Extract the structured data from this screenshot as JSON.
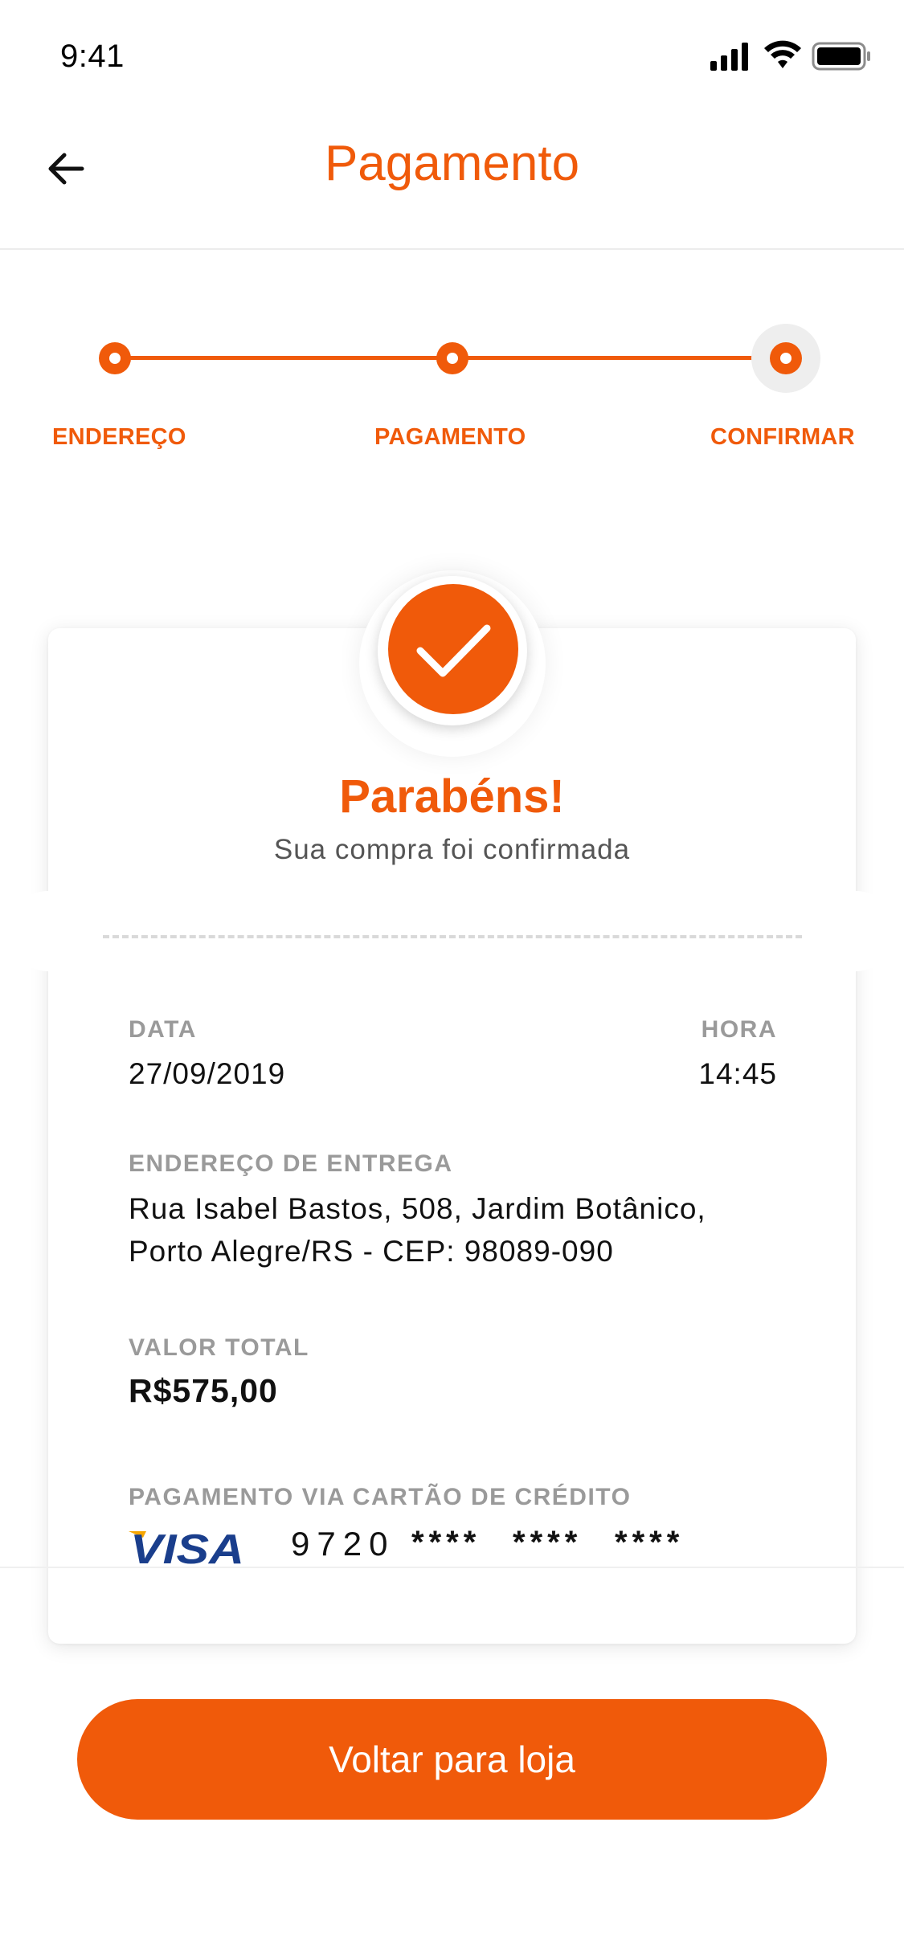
{
  "status_bar": {
    "time": "9:41",
    "icons": [
      "signal-icon",
      "wifi-icon",
      "battery-icon"
    ]
  },
  "header": {
    "title": "Pagamento",
    "back_icon": "arrow-left-icon"
  },
  "stepper": {
    "steps": [
      {
        "label": "ENDEREÇO",
        "state": "completed"
      },
      {
        "label": "PAGAMENTO",
        "state": "completed"
      },
      {
        "label": "CONFIRMAR",
        "state": "active"
      }
    ]
  },
  "confirmation": {
    "icon": "checkmark-icon",
    "title": "Parabéns!",
    "subtitle": "Sua compra foi confirmada"
  },
  "details": {
    "date_label": "DATA",
    "date_value": "27/09/2019",
    "time_label": "HORA",
    "time_value": "14:45",
    "address_label": "ENDEREÇO DE ENTREGA",
    "address_line1": "Rua Isabel Bastos, 508, Jardim Botânico,",
    "address_line2": "Porto Alegre/RS - CEP: 98089-090",
    "total_label": "VALOR TOTAL",
    "total_value": "R$575,00",
    "payment_label": "PAGAMENTO VIA CARTÃO DE CRÉDITO",
    "card_brand": "VISA",
    "card_digits": "9720",
    "card_mask": [
      "****",
      "****",
      "****"
    ]
  },
  "actions": {
    "back_to_store": "Voltar para loja"
  },
  "colors": {
    "accent": "#F05A0A",
    "label_gray": "#9a9a9a",
    "visa_blue": "#1a3e8c",
    "visa_gold": "#F7A600"
  }
}
